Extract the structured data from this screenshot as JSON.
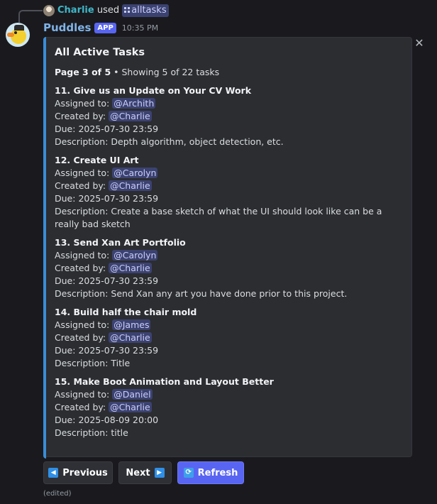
{
  "reply": {
    "user": "Charlie",
    "used": "used",
    "command": "alltasks"
  },
  "message": {
    "bot_name": "Puddles",
    "app_badge": "APP",
    "timestamp": "10:35 PM",
    "edited": "(edited)"
  },
  "embed": {
    "title": "All Active Tasks",
    "page_label": "Page 3 of 5",
    "page_rest": " • Showing 5 of 22 tasks",
    "labels": {
      "assigned": "Assigned to: ",
      "created": "Created by: ",
      "due": "Due: ",
      "description": "Description: "
    },
    "tasks": [
      {
        "title": "11. Give us an Update on Your CV Work",
        "assigned": "@Archith",
        "created": "@Charlie",
        "due": "2025-07-30 23:59",
        "description": "Depth algorithm, object detection, etc."
      },
      {
        "title": "12. Create UI Art",
        "assigned": "@Carolyn",
        "created": "@Charlie",
        "due": "2025-07-30 23:59",
        "description": "Create a base sketch of what the UI should look like can be a really bad sketch"
      },
      {
        "title": "13. Send Xan Art Portfolio",
        "assigned": "@Carolyn",
        "created": "@Charlie",
        "due": "2025-07-30 23:59",
        "description": "Send Xan any art you have done prior to this project."
      },
      {
        "title": "14. Build half the chair mold",
        "assigned": "@James",
        "created": "@Charlie",
        "due": "2025-07-30 23:59",
        "description": "Title"
      },
      {
        "title": "15. Make Boot Animation and Layout Better",
        "assigned": "@Daniel",
        "created": "@Charlie",
        "due": "2025-08-09 20:00",
        "description": "title"
      }
    ]
  },
  "buttons": {
    "previous": "Previous",
    "next": "Next",
    "refresh": "Refresh"
  },
  "colors": {
    "background": "#1a1a1e",
    "embed_bg": "#2b2d31",
    "embed_accent": "#3a8dd6",
    "bot_name": "#7fb3e8",
    "reply_user": "#3fb6c7",
    "mention_bg": "#3c4270",
    "mention_text": "#c9cdfb",
    "primary_button": "#5865f2",
    "secondary_button": "#2e3035"
  },
  "icons": {
    "close": "close-icon",
    "previous": "arrow-left-icon",
    "next": "arrow-right-icon",
    "refresh": "refresh-icon",
    "command": "slash-command-icon"
  }
}
